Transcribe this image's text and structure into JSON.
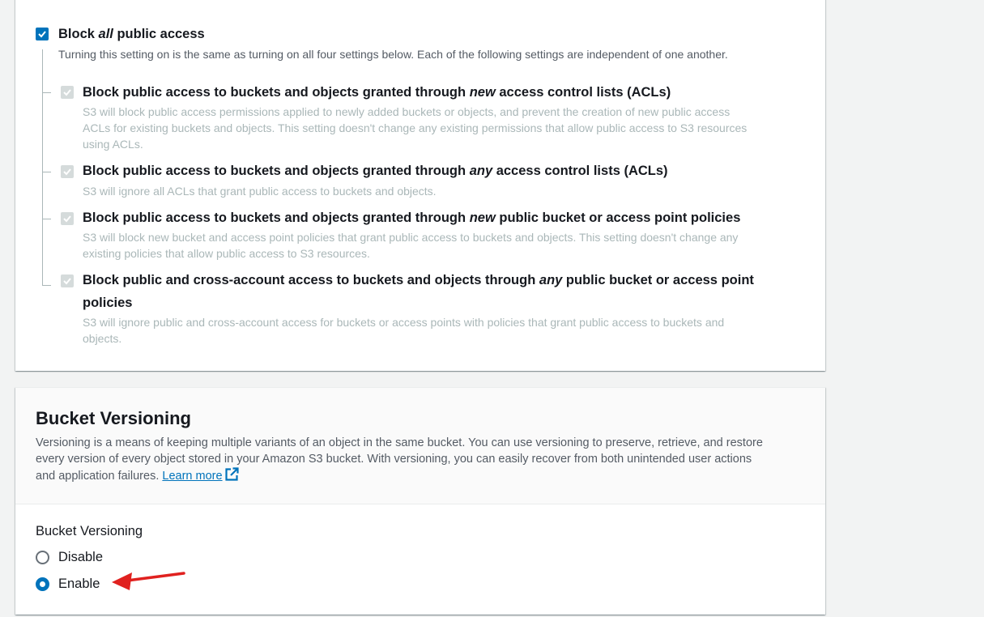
{
  "block_public_access": {
    "master": {
      "label_pre": "Block ",
      "label_em": "all",
      "label_post": " public access",
      "checked": true,
      "description": "Turning this setting on is the same as turning on all four settings below. Each of the following settings are independent of one another."
    },
    "items": [
      {
        "title_pre": "Block public access to buckets and objects granted through ",
        "title_em": "new",
        "title_post": " access control lists (ACLs)",
        "desc_lines": [
          "S3 will block public access permissions applied to newly added buckets or objects, and prevent the creation of new public access",
          "ACLs for existing buckets and objects. This setting doesn't change any existing permissions that allow public access to S3 resources",
          "using ACLs."
        ]
      },
      {
        "title_pre": "Block public access to buckets and objects granted through ",
        "title_em": "any",
        "title_post": " access control lists (ACLs)",
        "desc_lines": [
          "S3 will ignore all ACLs that grant public access to buckets and objects."
        ]
      },
      {
        "title_pre": "Block public access to buckets and objects granted through ",
        "title_em": "new",
        "title_post": " public bucket or access point policies",
        "desc_lines": [
          "S3 will block new bucket and access point policies that grant public access to buckets and objects. This setting doesn't change any",
          "existing policies that allow public access to S3 resources."
        ]
      },
      {
        "title_pre": "Block public and cross-account access to buckets and objects through ",
        "title_em": "any",
        "title_post": " public bucket or access point",
        "title_line2": "policies",
        "desc_lines": [
          "S3 will ignore public and cross-account access for buckets or access points with policies that grant public access to buckets and",
          "objects."
        ]
      }
    ]
  },
  "versioning": {
    "heading": "Bucket Versioning",
    "desc_lines": [
      "Versioning is a means of keeping multiple variants of an object in the same bucket. You can use versioning to preserve, retrieve, and restore",
      "every version of every object stored in your Amazon S3 bucket. With versioning, you can easily recover from both unintended user actions",
      "and application failures. "
    ],
    "learn_more": "Learn more",
    "field_label": "Bucket Versioning",
    "options": [
      {
        "label": "Disable",
        "selected": false
      },
      {
        "label": "Enable",
        "selected": true
      }
    ]
  },
  "colors": {
    "accent": "#0073bb",
    "annotation_arrow": "#e0211f"
  },
  "icons": [
    "checkmark-icon",
    "external-link-icon",
    "red-arrow-annotation"
  ]
}
